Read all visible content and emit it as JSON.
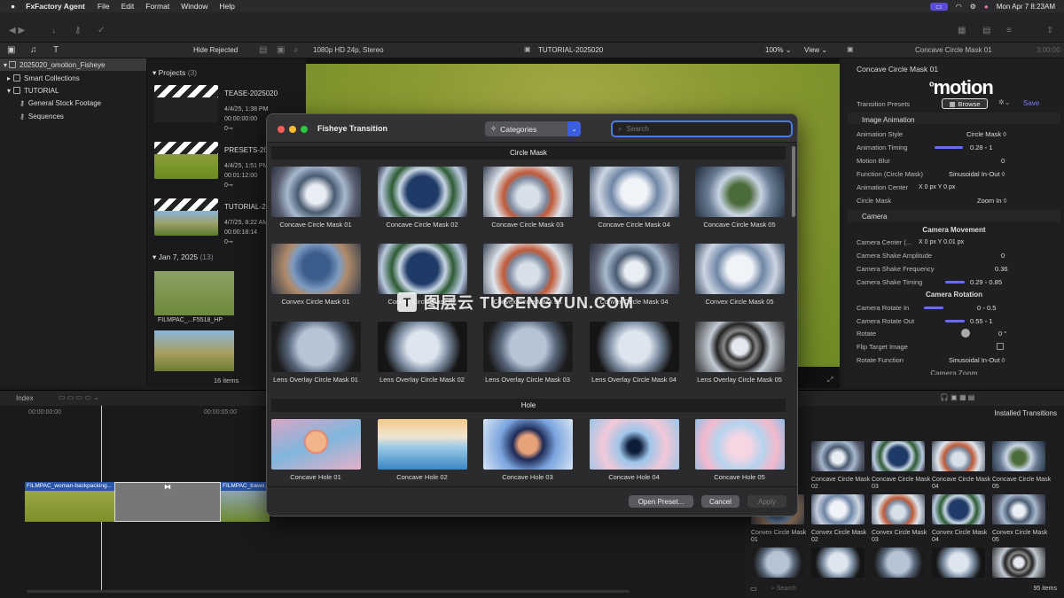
{
  "menubar": {
    "app": "FxFactory Agent",
    "items": [
      "File",
      "Edit",
      "Format",
      "Window",
      "Help"
    ],
    "datetime": "Mon Apr 7  8:23AM"
  },
  "library": {
    "filter": "Hide Rejected",
    "library_name": "2025020_omotion_Fisheye",
    "items": [
      "Smart Collections",
      "TUTORIAL",
      "General Stock Footage",
      "Sequences"
    ]
  },
  "browser": {
    "projects_header": "Projects",
    "projects_count": "(3)",
    "clips": [
      {
        "title": "TEASE-2025020",
        "date": "4/4/25, 1:38 PM",
        "duration": "00:00:00:00",
        "mark": "0⊸"
      },
      {
        "title": "PRESETS-20",
        "date": "4/4/25, 1:51 PM",
        "duration": "00:01:12:00",
        "mark": "0⊸"
      },
      {
        "title": "TUTORIAL-2",
        "date": "4/7/25, 8:22 AM",
        "duration": "00:00:18:14",
        "mark": "0⊸"
      }
    ],
    "date_header": "Jan 7, 2025",
    "date_count": "(13)",
    "footage_label": "FILMPAC_...F5518_HP",
    "items_count": "16 items"
  },
  "viewer": {
    "format": "1080p HD 24p, Stereo",
    "project": "TUTORIAL-2025020",
    "zoom": "100%",
    "view": "View"
  },
  "inspector": {
    "bar_title": "Concave Circle Mask 01",
    "bar_time": "3:00:00",
    "title": "Concave Circle Mask 01",
    "logo": "motion",
    "presets_label": "Transition Presets",
    "browse_label": "Browse",
    "save_label": "Save",
    "image_animation": "Image Animation",
    "rows_a": [
      {
        "label": "Animation Style",
        "value": "Circle Mask ◊"
      },
      {
        "label": "Animation Timing",
        "value": "0.28 ◦ 1"
      },
      {
        "label": "Motion Blur",
        "value": "0"
      },
      {
        "label": "Function (Circle Mask)",
        "value": "Sinusoidal In-Out ◊"
      },
      {
        "label": "Animation Center",
        "value": "X       0  px     Y        0  px"
      },
      {
        "label": "Circle Mask",
        "value": "Zoom In ◊"
      }
    ],
    "camera": "Camera",
    "camera_movement": "Camera Movement",
    "rows_b": [
      {
        "label": "Camera Center (...",
        "value": "X       0  px     Y     0.01  px"
      },
      {
        "label": "Camera Shake Amplitude",
        "value": "0"
      },
      {
        "label": "Camera Shake Frequency",
        "value": "0.36"
      },
      {
        "label": "Camera Shake Timing",
        "value": "0.29 ◦ 0.85"
      }
    ],
    "camera_rotation": "Camera Rotation",
    "rows_c": [
      {
        "label": "Camera Rotate In",
        "value": "0 ◦ 0.5"
      },
      {
        "label": "Camera Rotate Out",
        "value": "0.55 ◦ 1"
      },
      {
        "label": "Rotate",
        "value": "0 °"
      },
      {
        "label": "Flip Target Image",
        "value": ""
      },
      {
        "label": "Rotate Function",
        "value": "Sinusoidal In-Out ◊"
      }
    ],
    "camera_zoom": "Camera Zoom"
  },
  "timeline": {
    "index": "Index",
    "tc_start": "00:00:00:00",
    "tc_mid": "00:00:05:00",
    "clip_left": "FILMPAC_woman-backpacking...",
    "clip_right": "FILMPAC_travel..."
  },
  "transitions_browser": {
    "title": "Installed Transitions",
    "rows": [
      [
        "Concave Circle Mask 02",
        "Concave Circle Mask 03",
        "Concave Circle Mask 04",
        "Concave Circle Mask 05"
      ],
      [
        "Convex Circle Mask 01",
        "Convex Circle Mask 02",
        "Convex Circle Mask 03",
        "Convex Circle Mask 04",
        "Convex Circle Mask 05"
      ]
    ],
    "search_placeholder": "Search",
    "count": "95 items"
  },
  "dialog": {
    "title": "Fisheye Transition",
    "categories_label": "Categories",
    "search_placeholder": "Search",
    "group1": "Circle Mask",
    "row1": [
      "Concave Circle Mask 01",
      "Concave Circle Mask 02",
      "Concave Circle Mask 03",
      "Concave Circle Mask 04",
      "Concave Circle Mask 05"
    ],
    "row2": [
      "Convex Circle Mask 01",
      "Convex Circle Mask 02",
      "Convex Circle Mask 03",
      "Convex Circle Mask 04",
      "Convex Circle Mask 05"
    ],
    "row3": [
      "Lens Overlay Circle Mask 01",
      "Lens Overlay Circle Mask 02",
      "Lens Overlay Circle Mask 03",
      "Lens Overlay Circle Mask 04",
      "Lens Overlay Circle Mask 05"
    ],
    "group2": "Hole",
    "row4": [
      "Concave Hole 01",
      "Concave Hole 02",
      "Concave Hole 03",
      "Concave Hole 04",
      "Concave Hole 05"
    ],
    "open_preset": "Open Preset...",
    "cancel": "Cancel",
    "apply": "Apply"
  },
  "watermark": "图层云  TUCENGYUN.COM"
}
